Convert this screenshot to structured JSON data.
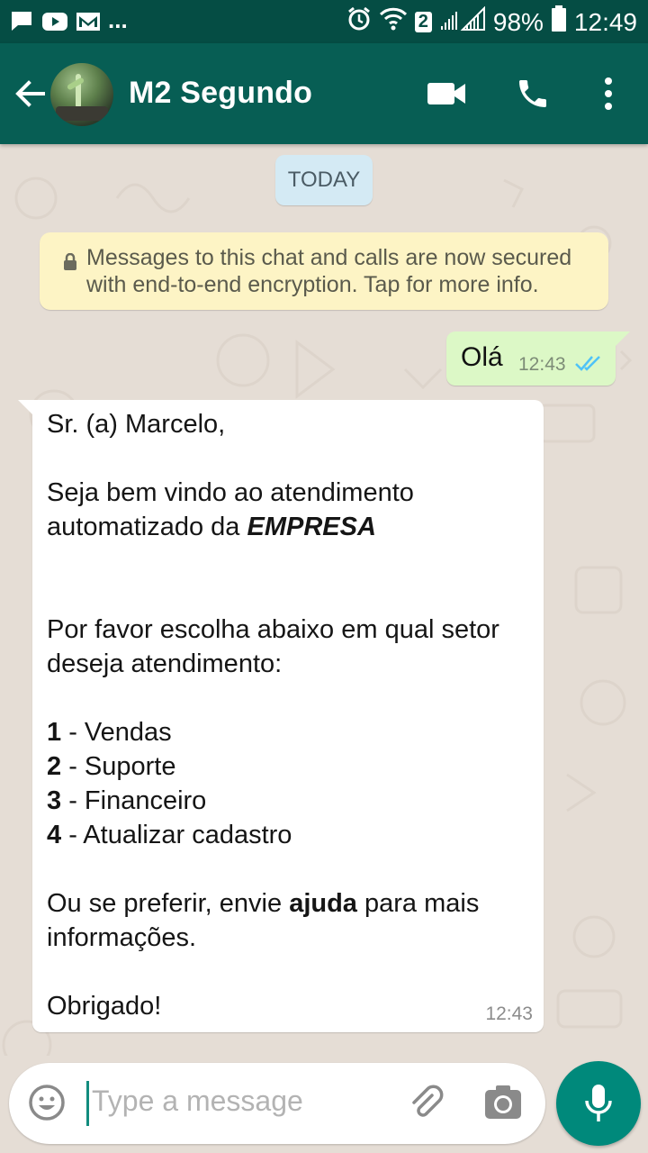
{
  "status_bar": {
    "battery": "98%",
    "time": "12:49",
    "sim_badge": "2",
    "more_notifications": "..."
  },
  "header": {
    "contact_name": "M2 Segundo"
  },
  "chat": {
    "date_label": "TODAY",
    "encryption_notice": "Messages to this chat and calls are now secured with end-to-end encryption. Tap for more info.",
    "messages": [
      {
        "direction": "outgoing",
        "text": "Olá",
        "time": "12:43",
        "status": "read"
      },
      {
        "direction": "incoming",
        "time": "12:43",
        "greeting": "Sr. (a) Marcelo,",
        "welcome_line1": "Seja bem vindo ao atendimento",
        "welcome_line2_prefix": "automatizado da ",
        "company": "EMPRESA",
        "prompt": "Por favor escolha abaixo em qual setor deseja atendimento:",
        "options": [
          {
            "number": "1",
            "label": " - Vendas"
          },
          {
            "number": "2",
            "label": " - Suporte"
          },
          {
            "number": "3",
            "label": " - Financeiro"
          },
          {
            "number": "4",
            "label": " - Atualizar cadastro"
          }
        ],
        "help_prefix": "Ou se preferir, envie ",
        "help_keyword": "ajuda",
        "help_suffix": " para mais informações.",
        "closing": "Obrigado!"
      }
    ]
  },
  "composer": {
    "placeholder": "Type a message"
  },
  "colors": {
    "status_bar": "#054d44",
    "app_bar": "#075e54",
    "outgoing_bubble": "#dcf8c6",
    "incoming_bubble": "#ffffff",
    "encryption_notice_bg": "#fdf4c5",
    "date_chip_bg": "#d4eaf4",
    "mic_button": "#00897b",
    "read_ticks": "#4fc3f7"
  },
  "icons": [
    "chat-notification-icon",
    "youtube-icon",
    "gmail-icon",
    "alarm-icon",
    "wifi-icon",
    "signal-icon",
    "battery-icon",
    "back-arrow-icon",
    "video-call-icon",
    "phone-icon",
    "more-vert-icon",
    "lock-icon",
    "double-check-icon",
    "emoji-icon",
    "attach-icon",
    "camera-icon",
    "mic-icon"
  ]
}
